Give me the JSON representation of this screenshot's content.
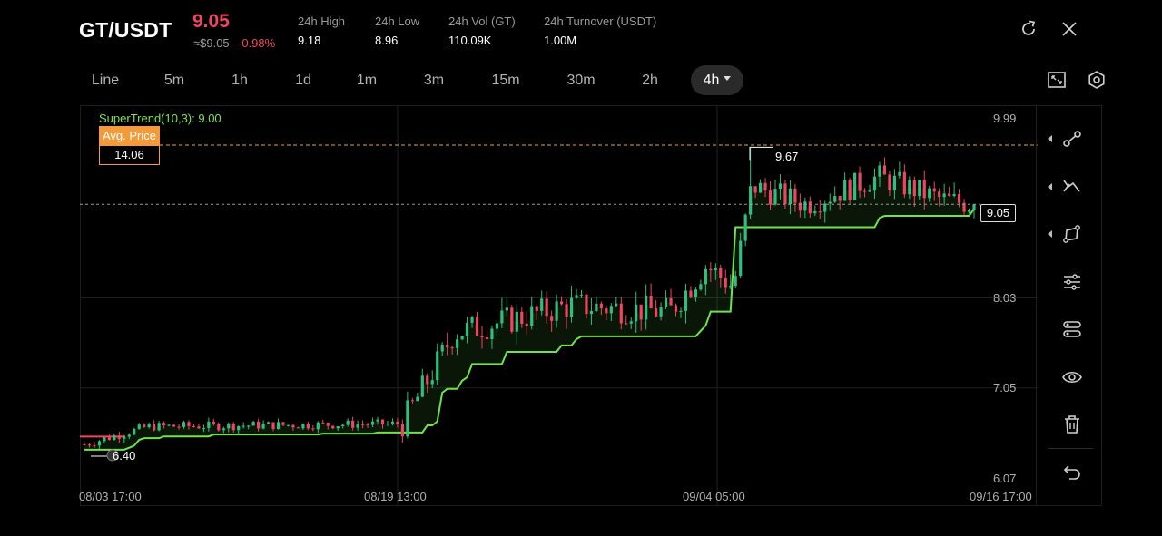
{
  "header": {
    "pair": "GT/USDT",
    "price": "9.05",
    "approx_price": "≈$9.05",
    "change": "-0.98%",
    "stats": [
      {
        "label": "24h  High",
        "value": "9.18"
      },
      {
        "label": "24h  Low",
        "value": "8.96"
      },
      {
        "label": "24h  Vol (GT)",
        "value": "110.09K"
      },
      {
        "label": "24h  Turnover (USDT)",
        "value": "1.00M"
      }
    ],
    "icons": [
      "refresh-icon",
      "close-icon"
    ]
  },
  "toolbar": {
    "tabs": [
      "Line",
      "5m",
      "1h",
      "1d",
      "1m",
      "3m",
      "15m",
      "30m",
      "2h",
      "4h"
    ],
    "active_tab": "4h",
    "icons": [
      "fullscreen-icon",
      "settings-icon"
    ]
  },
  "indicator": {
    "supertrend_label": "SuperTrend(10,3): 9.00",
    "avg_price_title": "Avg. Price",
    "avg_price_value": "14.06",
    "high_marker": "9.67",
    "low_marker": "6.40",
    "current_price_tag": "9.05"
  },
  "chart_data": {
    "type": "candlestick",
    "y_ticks": [
      "9.99",
      "8.03",
      "7.05",
      "6.07"
    ],
    "x_ticks": [
      "08/03 17:00",
      "08/19 13:00",
      "09/04 05:00",
      "09/16 17:00"
    ],
    "ylim": [
      6.07,
      10.2
    ],
    "series": [
      {
        "name": "SuperTrend(10,3)",
        "last_value": 9.0
      },
      {
        "name": "Avg. Price",
        "value": 14.06
      }
    ],
    "anchors": [
      {
        "x": "08/03 17:00",
        "y": 6.42
      },
      {
        "x": "08/09",
        "y": 6.63
      },
      {
        "x": "08/18",
        "y": 6.66
      },
      {
        "x": "08/20",
        "y": 7.25
      },
      {
        "x": "08/22",
        "y": 7.65
      },
      {
        "x": "08/24",
        "y": 7.78
      },
      {
        "x": "08/28",
        "y": 7.95
      },
      {
        "x": "09/01",
        "y": 7.88
      },
      {
        "x": "09/03",
        "y": 8.38
      },
      {
        "x": "09/04 05:00",
        "y": 8.15
      },
      {
        "x": "09/05",
        "y": 9.25
      },
      {
        "x": "09/08",
        "y": 9.05
      },
      {
        "x": "09/11",
        "y": 9.35
      },
      {
        "x": "09/14",
        "y": 9.1
      },
      {
        "x": "09/16 17:00",
        "y": 9.05
      }
    ],
    "high": {
      "value": 9.67,
      "x": "09/05"
    },
    "low": {
      "value": 6.4,
      "x": "08/03"
    },
    "colors": {
      "up": "#2dbf7d",
      "down": "#f0455f",
      "supertrend": "#6fe34a",
      "avg_price": "#f39a3a"
    }
  },
  "sidebar": {
    "icons": [
      "trend-line-icon",
      "multi-line-icon",
      "shape-icon",
      "indicators-icon",
      "layers-icon",
      "visibility-icon",
      "trash-icon",
      "undo-icon"
    ]
  }
}
